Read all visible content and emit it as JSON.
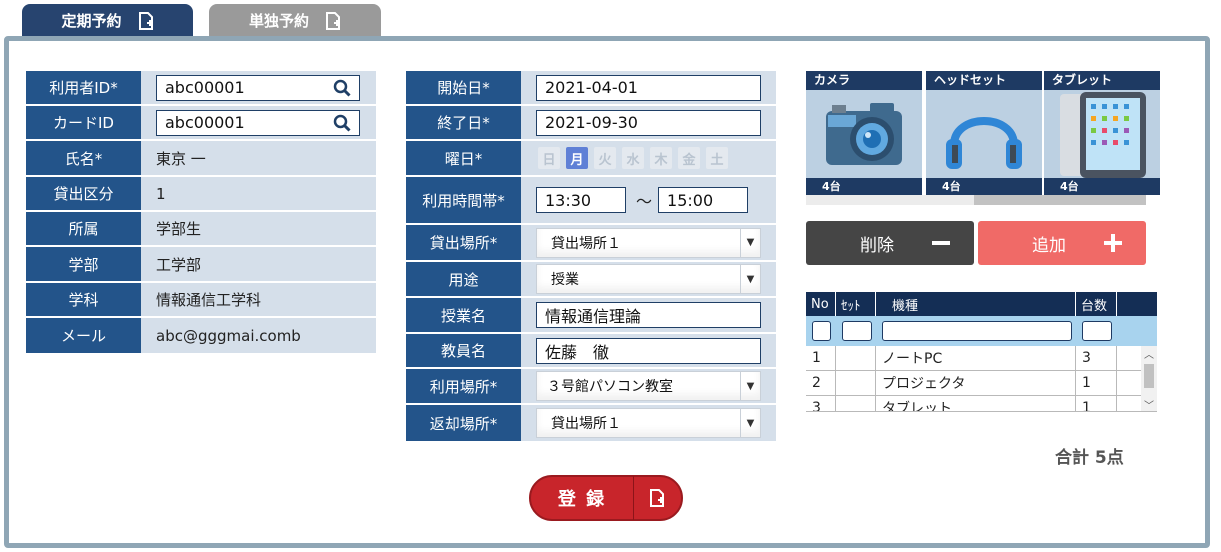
{
  "tabs": [
    {
      "label": "定期予約",
      "icon": "file-plus-icon",
      "active": true
    },
    {
      "label": "単独予約",
      "icon": "file-plus-icon",
      "active": false
    }
  ],
  "user": {
    "fields": [
      {
        "label": "利用者ID*",
        "value": "abc00001",
        "input": true
      },
      {
        "label": "カードID",
        "value": "abc00001",
        "input": true
      },
      {
        "label": "氏名*",
        "value": "東京 一"
      },
      {
        "label": "貸出区分",
        "value": "1"
      },
      {
        "label": "所属",
        "value": "学部生"
      },
      {
        "label": "学部",
        "value": "工学部"
      },
      {
        "label": "学科",
        "value": "情報通信工学科"
      },
      {
        "label": "メール",
        "value": "abc@gggmai.comb"
      }
    ]
  },
  "schedule": {
    "start_label": "開始日*",
    "start_value": "2021-04-01",
    "end_label": "終了日*",
    "end_value": "2021-09-30",
    "weekday_label": "曜日*",
    "weekdays": [
      "日",
      "月",
      "火",
      "水",
      "木",
      "金",
      "土"
    ],
    "weekday_selected": "月",
    "time_label": "利用時間帯*",
    "time_from": "13:30",
    "time_sep": "〜",
    "time_to": "15:00",
    "lend_place_label": "貸出場所*",
    "lend_place_value": "貸出場所１",
    "purpose_label": "用途",
    "purpose_value": "授業",
    "class_label": "授業名",
    "class_value": "情報通信理論",
    "teacher_label": "教員名",
    "teacher_value": "佐藤　徹",
    "use_place_label": "利用場所*",
    "use_place_value": "３号館パソコン教室",
    "return_place_label": "返却場所*",
    "return_place_value": "貸出場所１"
  },
  "equipment": [
    {
      "name": "カメラ",
      "count": "4台",
      "icon": "camera-icon"
    },
    {
      "name": "ヘッドセット",
      "count": "4台",
      "icon": "headset-icon"
    },
    {
      "name": "タブレット",
      "count": "4台",
      "icon": "tablet-icon"
    }
  ],
  "actions": {
    "delete_label": "削除",
    "add_label": "追加"
  },
  "grid": {
    "headers": [
      "No",
      "ｾｯﾄ",
      "機種",
      "台数"
    ],
    "rows": [
      {
        "no": "1",
        "set": "",
        "model": "ノートPC",
        "qty": "3"
      },
      {
        "no": "2",
        "set": "",
        "model": "プロジェクタ",
        "qty": "1"
      },
      {
        "no": "3",
        "set": "",
        "model": "タブレット",
        "qty": "1"
      }
    ]
  },
  "total": "合計 5点",
  "register_label": "登 録",
  "colors": {
    "navy": "#23548a",
    "red": "#c8252b",
    "add": "#f06a67",
    "delete": "#454545"
  }
}
